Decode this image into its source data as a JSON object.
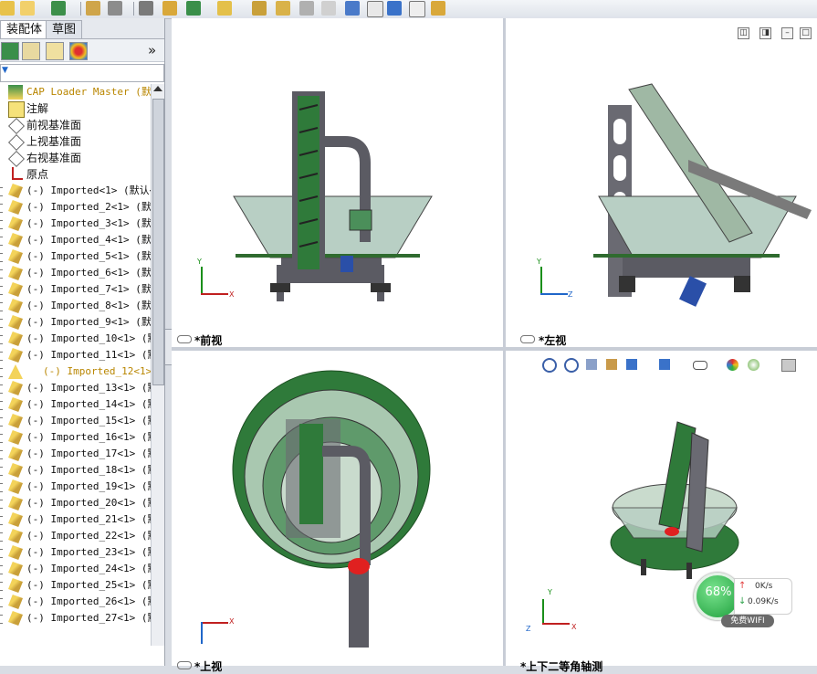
{
  "tabs": {
    "assembly": "装配体",
    "sketch": "草图"
  },
  "panel": {
    "expand_glyph": "»",
    "filter_glyph": "▼"
  },
  "tree": {
    "root": "CAP Loader Master (默认",
    "fixed": [
      {
        "label": "注解",
        "icon": "annotation-icon"
      },
      {
        "label": "前视基准面",
        "icon": "plane-icon"
      },
      {
        "label": "上视基准面",
        "icon": "plane-icon"
      },
      {
        "label": "右视基准面",
        "icon": "plane-icon"
      },
      {
        "label": "原点",
        "icon": "origin-icon"
      }
    ],
    "parts": [
      "(-) Imported<1> (默认<",
      "(-) Imported_2<1> (默认",
      "(-) Imported_3<1> (默认",
      "(-) Imported_4<1> (默认",
      "(-) Imported_5<1> (默认",
      "(-) Imported_6<1> (默认",
      "(-) Imported_7<1> (默认",
      "(-) Imported_8<1> (默认",
      "(-) Imported_9<1> (默认",
      "(-) Imported_10<1> (默",
      "(-) Imported_11<1> (默",
      "(-) Imported_12<1>",
      "(-) Imported_13<1> (默",
      "(-) Imported_14<1> (默",
      "(-) Imported_15<1> (默",
      "(-) Imported_16<1> (默",
      "(-) Imported_17<1> (默",
      "(-) Imported_18<1> (默",
      "(-) Imported_19<1> (默",
      "(-) Imported_20<1> (默",
      "(-) Imported_21<1> (默",
      "(-) Imported_22<1> (默",
      "(-) Imported_23<1> (默",
      "(-) Imported_24<1> (默",
      "(-) Imported_25<1> (默",
      "(-) Imported_26<1> (默",
      "(-) Imported_27<1> (默"
    ]
  },
  "views": {
    "front": "*前视",
    "left": "*左视",
    "top": "*上视",
    "iso": "*上下二等角轴测"
  },
  "axes": {
    "x": "X",
    "y": "Y",
    "z": "Z"
  },
  "wifi": {
    "percent": "68%",
    "up": "0K/s",
    "down": "0.09K/s",
    "label": "免费WIFI"
  },
  "colors": {
    "part_green": "#2f7a3a",
    "steel": "#5b5b63",
    "glass": "#b8cfc4",
    "accent_red": "#e02020",
    "wifi_green": "#1e9f3c"
  }
}
